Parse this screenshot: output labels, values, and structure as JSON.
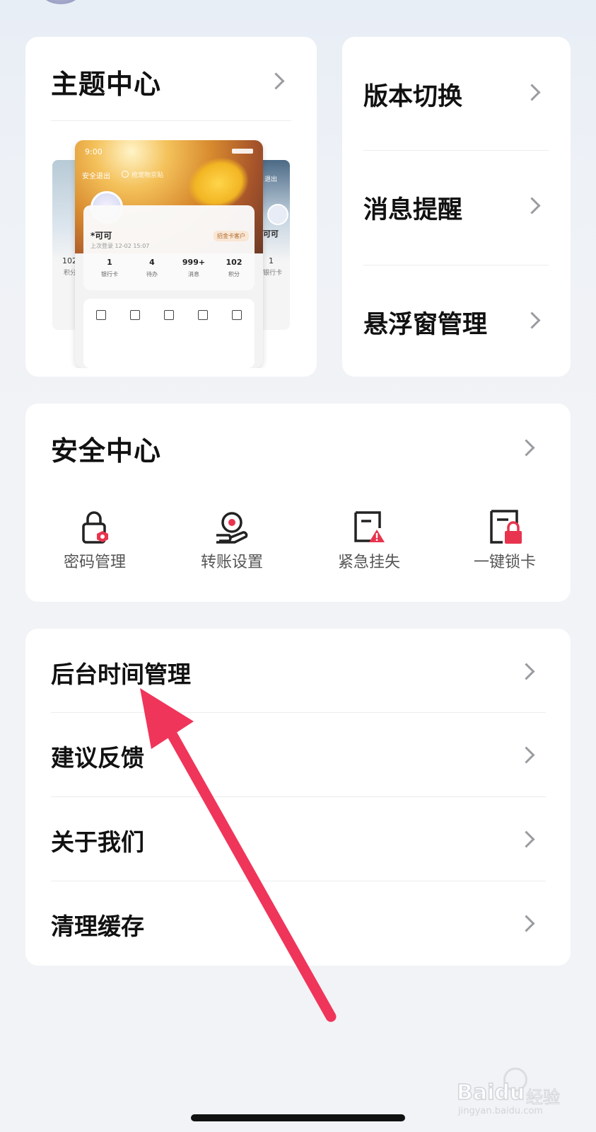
{
  "theme_card": {
    "title": "主题中心",
    "preview": {
      "time": "9:00",
      "logout": "安全退出",
      "search_placeholder": "抢宠物京贴",
      "username": "*可可",
      "last_login": "上次登录 12-02 15:07",
      "badge": "招金卡客户",
      "stats": [
        {
          "value": "1",
          "label": "银行卡"
        },
        {
          "value": "4",
          "label": "待办"
        },
        {
          "value": "999+",
          "label": "消息"
        },
        {
          "value": "102",
          "label": "积分"
        }
      ],
      "side_left": {
        "value": "102",
        "label": "积分"
      },
      "side_right": {
        "name": "可可",
        "value": "1",
        "label": "银行卡",
        "logout": "退出"
      }
    }
  },
  "right_menu": {
    "items": [
      {
        "label": "版本切换"
      },
      {
        "label": "消息提醒"
      },
      {
        "label": "悬浮窗管理"
      }
    ]
  },
  "security": {
    "title": "安全中心",
    "items": [
      {
        "label": "密码管理",
        "icon": "lock-icon"
      },
      {
        "label": "转账设置",
        "icon": "transfer-hand-icon"
      },
      {
        "label": "紧急挂失",
        "icon": "card-warning-icon"
      },
      {
        "label": "一键锁卡",
        "icon": "card-lock-icon"
      }
    ]
  },
  "settings_list": {
    "items": [
      {
        "label": "后台时间管理"
      },
      {
        "label": "建议反馈"
      },
      {
        "label": "关于我们"
      },
      {
        "label": "清理缓存"
      }
    ]
  },
  "watermark": {
    "brand": "Baidu",
    "sub": "经验",
    "url": "jingyan.baidu.com"
  },
  "colors": {
    "accent": "#e8344e",
    "arrow": "#f0355a"
  }
}
